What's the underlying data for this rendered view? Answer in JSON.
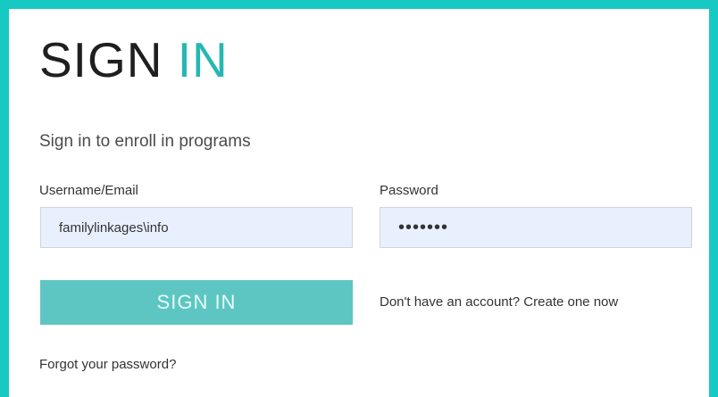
{
  "colors": {
    "frame": "#17c9c3",
    "panel": "#ffffff",
    "accent": "#27b7b2",
    "button": "#5dc6c2",
    "field_background": "#e8f0fe"
  },
  "heading": {
    "part1": "SIGN",
    "part2": "IN"
  },
  "subtitle": "Sign in to enroll in programs",
  "username": {
    "label": "Username/Email",
    "value": "familylinkages\\info"
  },
  "password": {
    "label": "Password",
    "value": "•••••••"
  },
  "signin_button": "SIGN IN",
  "create_account_text": "Don't have an account? Create one now",
  "forgot_password_text": "Forgot your password?"
}
